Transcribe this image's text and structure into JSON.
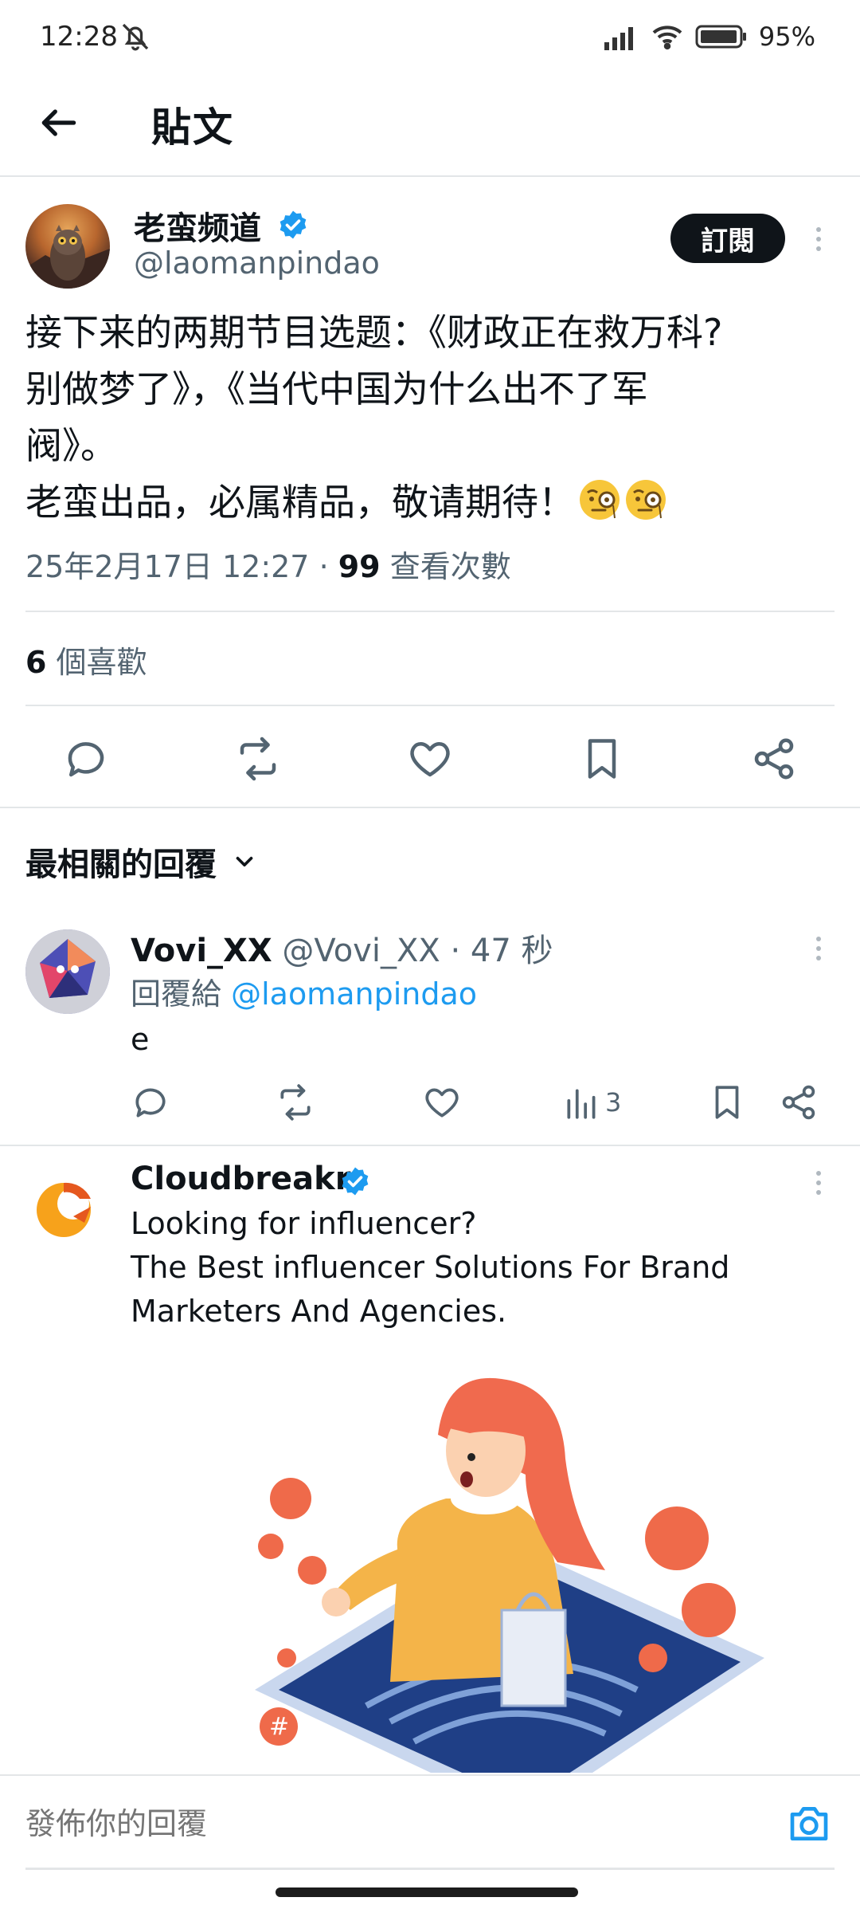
{
  "status_bar": {
    "time": "12:28",
    "battery": "95%"
  },
  "header": {
    "title": "貼文"
  },
  "post": {
    "author_name": "老蛮频道",
    "author_handle": "@laomanpindao",
    "subscribe_label": "訂閱",
    "body_lines": [
      "接下来的两期节目选题：《财政正在救万科?",
      "别做梦了》，《当代中国为什么出不了军",
      "阀》。",
      "老蛮出品，必属精品，敬请期待！"
    ],
    "timestamp": "25年2月17日 12:27",
    "separator": " · ",
    "views_count": "99",
    "views_label": " 查看次數",
    "likes_count": "6",
    "likes_label": " 個喜歡"
  },
  "replies_section": {
    "heading": "最相關的回覆"
  },
  "reply": {
    "name": "Vovi_XX",
    "handle_time": " @Vovi_XX · 47 秒",
    "reply_to_label": "回覆給 ",
    "reply_to_handle": "@laomanpindao",
    "text": "e",
    "views": "3"
  },
  "ad": {
    "name": "Cloudbreakr",
    "line1": "Looking for influencer?",
    "line2": "The Best influencer Solutions For Brand",
    "line3": "Marketers And Agencies."
  },
  "composer": {
    "placeholder": "發佈你的回覆"
  },
  "colors": {
    "accent": "#1d9bf0",
    "text_primary": "#0f1419",
    "text_secondary": "#536471",
    "divider": "#e3e6e8"
  }
}
